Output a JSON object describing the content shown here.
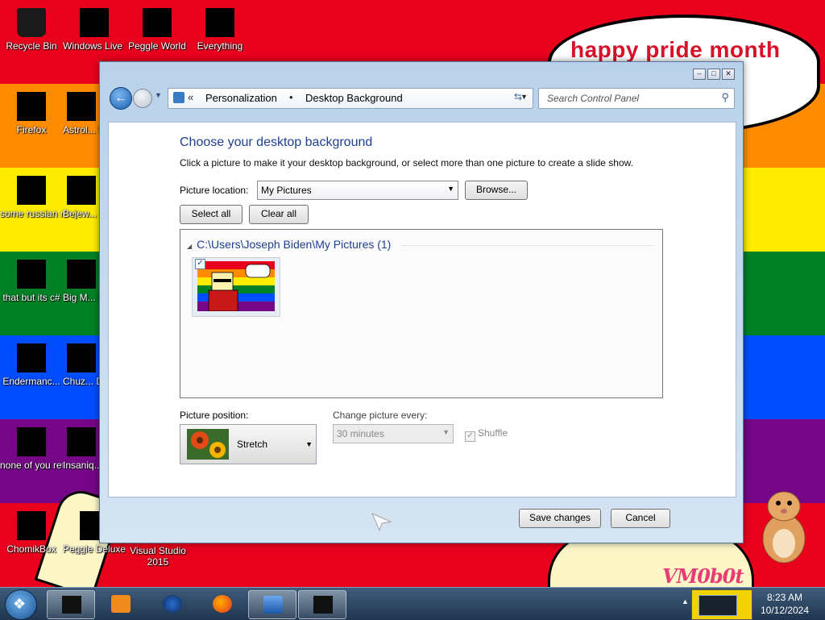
{
  "desktop": {
    "banner": "happy pride month",
    "watermark": "VM0b0t",
    "icons": [
      {
        "label": "Recycle Bin"
      },
      {
        "label": "Windows Live Ma..."
      },
      {
        "label": "Peggle World"
      },
      {
        "label": "Everything"
      },
      {
        "label": "Firefox"
      },
      {
        "label": "Astrol... Delu..."
      },
      {
        "label": "some russian ran a rat"
      },
      {
        "label": "Bejew... Delu..."
      },
      {
        "label": "that but its c#"
      },
      {
        "label": "Big M... Delu..."
      },
      {
        "label": "Endermanc..."
      },
      {
        "label": "Chuz... Delu..."
      },
      {
        "label": "none of you retards kno..."
      },
      {
        "label": "Insaniq... Delu..."
      },
      {
        "label": "ChomikBox"
      },
      {
        "label": "Peggle Deluxe"
      },
      {
        "label": "Visual Studio 2015"
      }
    ]
  },
  "window": {
    "breadcrumb": {
      "chevron": "«",
      "items": [
        "Personalization",
        "Desktop Background"
      ],
      "separator": "•"
    },
    "search_placeholder": "Search Control Panel",
    "heading": "Choose your desktop background",
    "description": "Click a picture to make it your desktop background, or select more than one picture to create a slide show.",
    "picture_location_label": "Picture location:",
    "picture_location_value": "My Pictures",
    "browse_label": "Browse...",
    "select_all_label": "Select all",
    "clear_all_label": "Clear all",
    "group_header": "C:\\Users\\Joseph Biden\\My Pictures (1)",
    "thumbnail_checked": true,
    "picture_position_label": "Picture position:",
    "picture_position_value": "Stretch",
    "change_every_label": "Change picture every:",
    "change_every_value": "30 minutes",
    "shuffle_label": "Shuffle",
    "save_label": "Save changes",
    "cancel_label": "Cancel"
  },
  "taskbar": {
    "time": "8:23 AM",
    "date": "10/12/2024"
  },
  "colors": {
    "rainbow": [
      "#e9001d",
      "#ff8b00",
      "#ffec00",
      "#008125",
      "#004dff",
      "#750787",
      "#e9001d"
    ],
    "heading_blue": "#1e3f90"
  }
}
